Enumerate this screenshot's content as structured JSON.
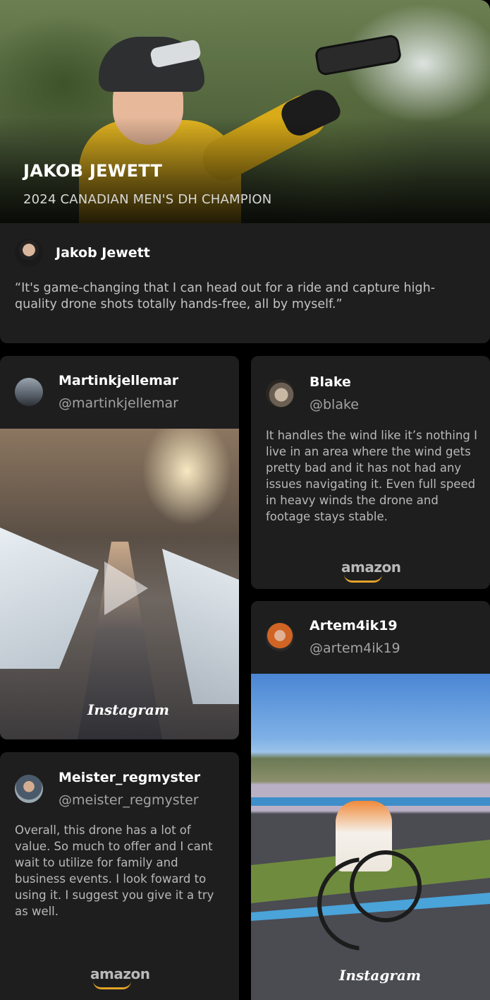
{
  "hero": {
    "name": "JAKOB JEWETT",
    "subtitle": "2024 CANADIAN MEN'S DH CHAMPION"
  },
  "testimonials": {
    "jakob": {
      "name": "Jakob Jewett",
      "quote": "“It's game-changing that I can head out for a ride and capture high-quality drone shots totally hands-free, all by myself.”"
    },
    "martin": {
      "name": "Martinkjellemar",
      "handle": "@martinkjellemar",
      "source": "Instagram"
    },
    "blake": {
      "name": "Blake",
      "handle": "@blake",
      "text": "It handles the wind like it’s nothing I live in an area where the wind gets pretty bad and it has not had any issues navigating it. Even full speed in heavy winds the drone and footage stays stable.",
      "source": "amazon"
    },
    "artem": {
      "name": "Artem4ik19",
      "handle": "@artem4ik19",
      "source": "Instagram"
    },
    "meister": {
      "name": "Meister_regmyster",
      "handle": "@meister_regmyster",
      "text": "Overall, this drone has a lot of value. So much to offer and I cant wait to utilize for family and business events. I look foward to using it. I suggest you give it a try as well.",
      "source": "amazon"
    }
  },
  "colors": {
    "background": "#000000",
    "card": "#1e1e1e",
    "muted_text": "#b9b9b9",
    "amazon_smile": "#e3a32a"
  },
  "icons": [
    "play-icon",
    "instagram-logo",
    "amazon-logo"
  ]
}
